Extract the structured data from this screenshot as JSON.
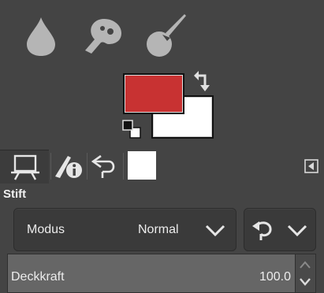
{
  "colors": {
    "panel_bg": "#444444",
    "icon_gray": "#b5b5b5",
    "foreground": "#c83232",
    "background": "#ffffff"
  },
  "tools": [
    {
      "icon": "ink-drop-icon"
    },
    {
      "icon": "smudge-icon"
    },
    {
      "icon": "paint-brush-icon"
    }
  ],
  "color_area": {
    "swap_icon": "swap-arrow-icon",
    "reset_icon": "default-colors-icon"
  },
  "tabs": [
    {
      "icon": "tool-options-icon"
    },
    {
      "icon": "pointer-info-icon"
    },
    {
      "icon": "undo-history-icon"
    },
    {
      "icon": "images-icon"
    }
  ],
  "panel": {
    "title": "Stift",
    "mode_label": "Modus",
    "mode_value": "Normal",
    "opacity_label": "Deckkraft",
    "opacity_value": "100.0",
    "opacity_percent": 100
  }
}
